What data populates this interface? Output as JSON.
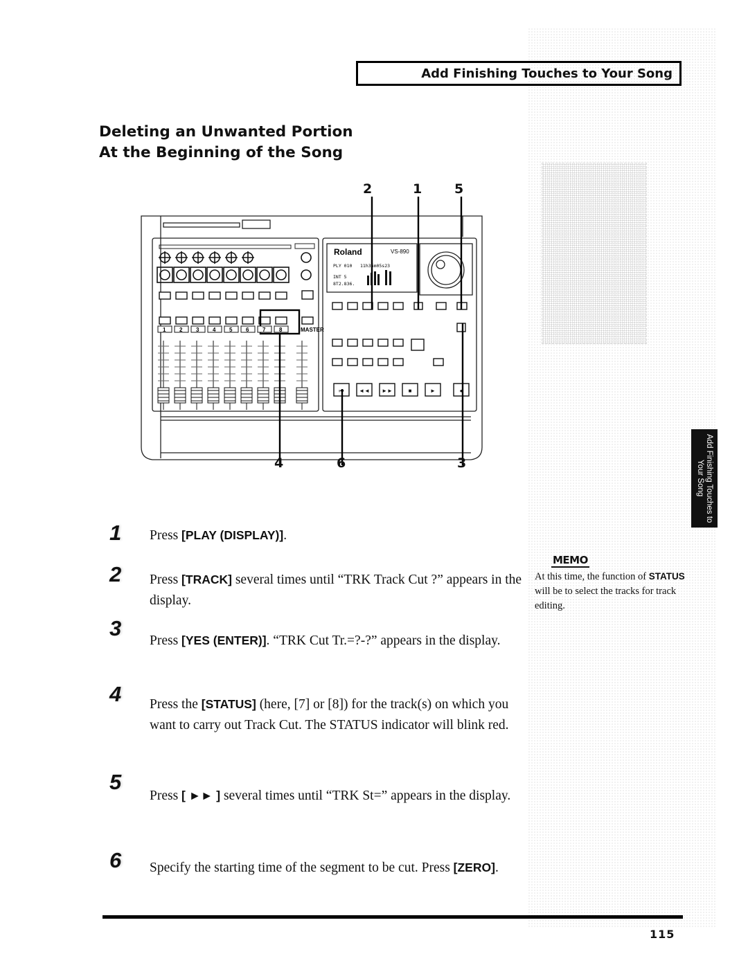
{
  "header": {
    "chapter_title": "Add Finishing Touches to Your Song"
  },
  "section": {
    "title_line1": "Deleting an Unwanted Portion",
    "title_line2": "At the Beginning of the Song"
  },
  "figure": {
    "device_brand": "Roland",
    "device_model": "VS-890",
    "display_lines": [
      "PLY 010",
      "11h36m05s23",
      "INT 5",
      "8T2.836."
    ],
    "master_label": "MASTER",
    "track_numbers": [
      "1",
      "2",
      "3",
      "4",
      "5",
      "6",
      "7",
      "8"
    ],
    "callouts": {
      "top": [
        "2",
        "1",
        "5"
      ],
      "bottom": [
        "4",
        "6",
        "3"
      ]
    }
  },
  "side_tab": {
    "label": "Add Finishing Touches to Your Song"
  },
  "steps": [
    {
      "num": "1",
      "pre": "Press ",
      "bold": "[PLAY (DISPLAY)]",
      "post": "."
    },
    {
      "num": "2",
      "pre": "Press ",
      "bold": "[TRACK]",
      "post": " several times until “TRK Track Cut ?” appears in the display."
    },
    {
      "num": "3",
      "pre": "Press ",
      "bold": "[YES (ENTER)]",
      "post": ". “TRK Cut Tr.=?-?” appears in the display."
    },
    {
      "num": "4",
      "pre": "Press the ",
      "bold": "[STATUS]",
      "post": " (here, [7] or [8]) for the track(s) on which you want to carry out Track Cut. The STATUS indicator will blink red."
    },
    {
      "num": "5",
      "pre": "Press ",
      "bold": "[ ►► ]",
      "post": " several times until “TRK St=” appears in the display."
    },
    {
      "num": "6",
      "pre": "Specify the starting time of the segment to be cut. Press ",
      "bold": "[ZERO]",
      "post": "."
    }
  ],
  "memo": {
    "label": "MEMO",
    "pre": "At this time, the function of ",
    "bold": "STATUS",
    "post": " will be to select the tracks for track editing."
  },
  "footer": {
    "page_number": "115"
  }
}
